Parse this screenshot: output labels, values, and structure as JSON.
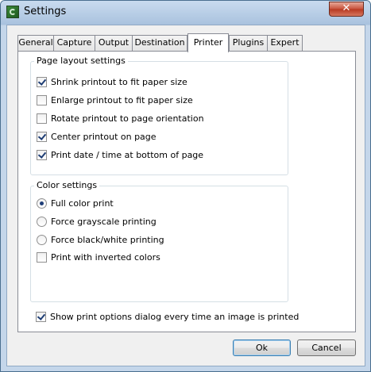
{
  "window": {
    "title": "Settings",
    "close_symbol": "✕",
    "app_icon": "greenshot-app-icon"
  },
  "tabs": [
    {
      "label": "General",
      "active": false
    },
    {
      "label": "Capture",
      "active": false
    },
    {
      "label": "Output",
      "active": false
    },
    {
      "label": "Destination",
      "active": false
    },
    {
      "label": "Printer",
      "active": true
    },
    {
      "label": "Plugins",
      "active": false
    },
    {
      "label": "Expert",
      "active": false
    }
  ],
  "page_layout": {
    "title": "Page layout settings",
    "options": [
      {
        "label": "Shrink printout to fit paper size",
        "checked": true
      },
      {
        "label": "Enlarge printout to fit paper size",
        "checked": false
      },
      {
        "label": "Rotate printout to page orientation",
        "checked": false
      },
      {
        "label": "Center printout on page",
        "checked": true
      },
      {
        "label": "Print date / time at bottom of page",
        "checked": true
      }
    ]
  },
  "color_settings": {
    "title": "Color settings",
    "radios": [
      {
        "label": "Full color print",
        "selected": true
      },
      {
        "label": "Force grayscale printing",
        "selected": false
      },
      {
        "label": "Force black/white printing",
        "selected": false
      }
    ],
    "inverted": {
      "label": "Print with inverted colors",
      "checked": false
    }
  },
  "show_dialog": {
    "label": "Show print options dialog every time an image is printed",
    "checked": true
  },
  "buttons": {
    "ok": "Ok",
    "cancel": "Cancel"
  }
}
